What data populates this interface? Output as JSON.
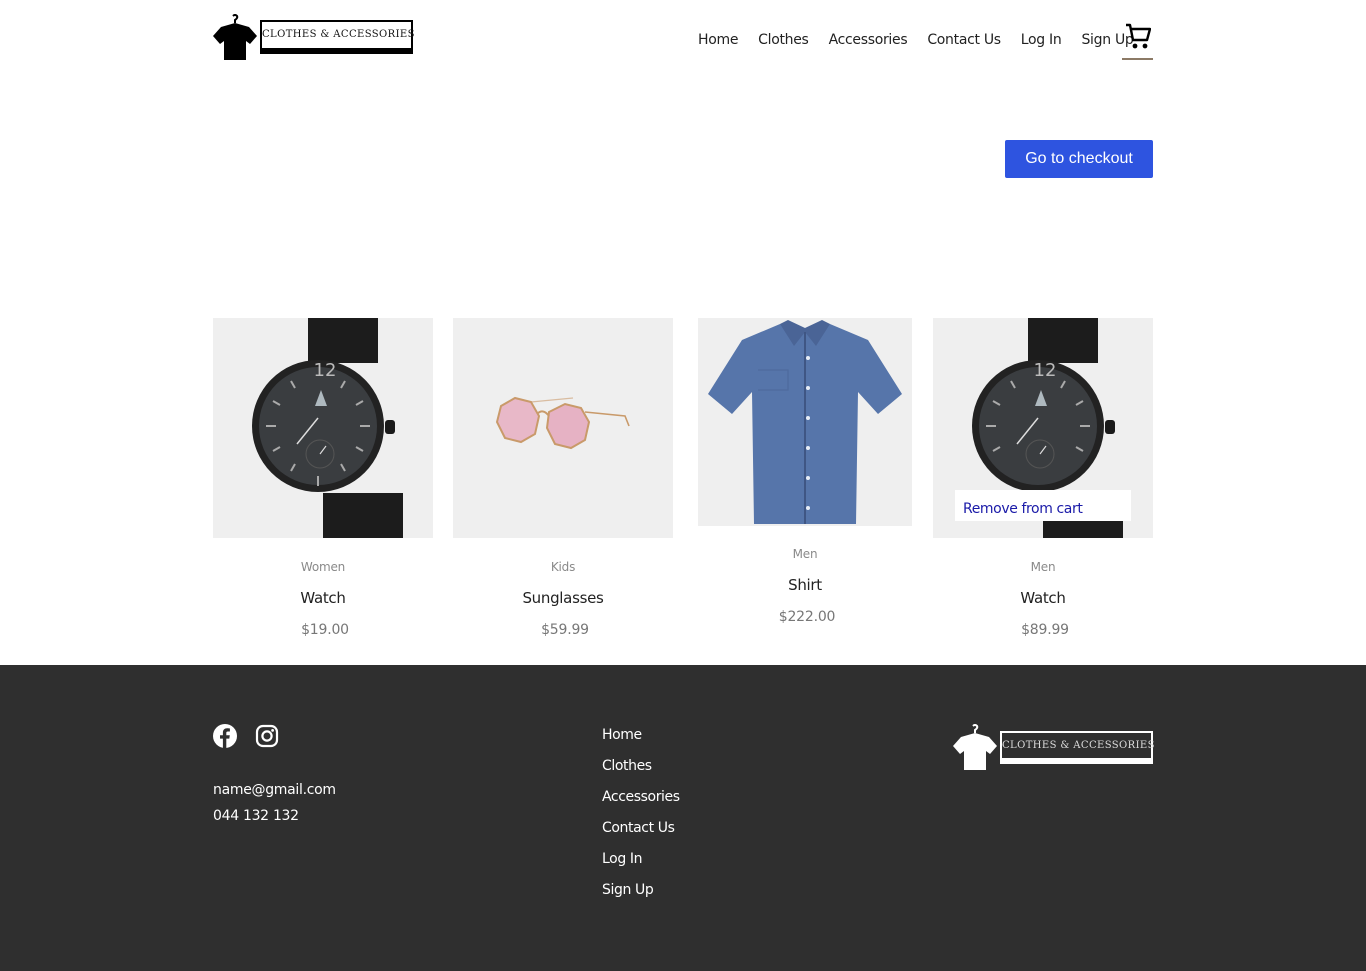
{
  "brand": {
    "logo_text": "CLOTHES & ACCESSORIES"
  },
  "nav": {
    "items": [
      "Home",
      "Clothes",
      "Accessories",
      "Contact Us",
      "Log In",
      "Sign Up"
    ],
    "cart_icon": "cart-icon"
  },
  "checkout": {
    "label": "Go to checkout",
    "color": "#2e54e0"
  },
  "products": [
    {
      "category": "Women",
      "name": "Watch",
      "price": "$19.00",
      "image": "watch"
    },
    {
      "category": "Kids",
      "name": "Sunglasses",
      "price": "$59.99",
      "image": "sunglasses"
    },
    {
      "category": "Men",
      "name": "Shirt",
      "price": "$222.00",
      "image": "shirt"
    },
    {
      "category": "Men",
      "name": "Watch",
      "price": "$89.99",
      "image": "watch",
      "hover_action": "Remove from cart"
    }
  ],
  "footer": {
    "social": [
      "facebook-icon",
      "instagram-icon"
    ],
    "email": "name@gmail.com",
    "phone": "044 132 132",
    "links": [
      "Home",
      "Clothes",
      "Accessories",
      "Contact Us",
      "Log In",
      "Sign Up"
    ],
    "logo_text": "CLOTHES & ACCESSORIES",
    "background": "#2f2f2f"
  }
}
